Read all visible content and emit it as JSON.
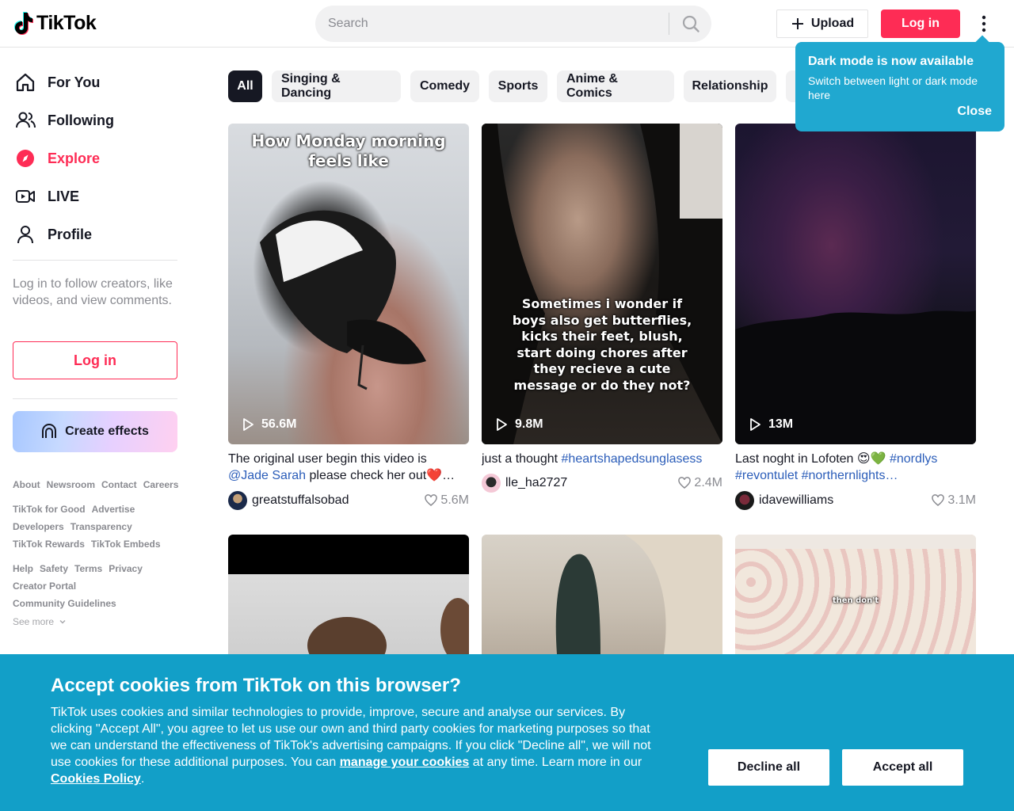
{
  "header": {
    "logo_text": "TikTok",
    "search_placeholder": "Search",
    "upload_label": "Upload",
    "login_label": "Log in"
  },
  "tooltip": {
    "title": "Dark mode is now available",
    "body": "Switch between light or dark mode here",
    "close_label": "Close"
  },
  "sidebar": {
    "nav": [
      {
        "label": "For You",
        "icon": "home-icon"
      },
      {
        "label": "Following",
        "icon": "following-icon"
      },
      {
        "label": "Explore",
        "icon": "compass-icon",
        "active": true
      },
      {
        "label": "LIVE",
        "icon": "live-icon"
      },
      {
        "label": "Profile",
        "icon": "profile-icon"
      }
    ],
    "login_note": "Log in to follow creators, like videos, and view comments.",
    "login_label": "Log in",
    "effects_label": "Create effects",
    "links_1": [
      "About",
      "Newsroom",
      "Contact",
      "Careers"
    ],
    "links_2": [
      "TikTok for Good",
      "Advertise",
      "Developers",
      "Transparency",
      "TikTok Rewards",
      "TikTok Embeds"
    ],
    "links_3": [
      "Help",
      "Safety",
      "Terms",
      "Privacy",
      "Creator Portal",
      "Community Guidelines"
    ],
    "see_more": "See more"
  },
  "categories": [
    "All",
    "Singing & Dancing",
    "Comedy",
    "Sports",
    "Anime & Comics",
    "Relationship"
  ],
  "videos": [
    {
      "caption": "How Monday morning feels like",
      "plays": "56.6M",
      "desc_text": "The original user begin this video is ",
      "desc_tag": "@Jade Sarah",
      "desc_tail": " please check her out❤️…",
      "author": "greatstuffalsobad",
      "likes": "5.6M"
    },
    {
      "caption": "Sometimes i wonder if boys also get butterflies, kicks their feet, blush, start doing chores after they recieve a cute message or do they not?",
      "plays": "9.8M",
      "desc_text": "just a thought ",
      "desc_tag": "#heartshapedsunglasess",
      "desc_tail": "",
      "author": "lle_ha2727",
      "likes": "2.4M"
    },
    {
      "caption": "",
      "plays": "13M",
      "desc_text": "Last noght in Lofoten 😍💚 ",
      "desc_tag": "#nordlys #revontulet #northernlights…",
      "desc_tail": "",
      "author": "idavewilliams",
      "likes": "3.1M"
    },
    {
      "caption": ""
    },
    {
      "caption": ""
    },
    {
      "caption": "then don't"
    }
  ],
  "cookie": {
    "title": "Accept cookies from TikTok on this browser?",
    "text_1": "TikTok uses cookies and similar technologies to provide, improve, secure and analyse our services. By clicking \"Accept All\", you agree to let us use our own and third party cookies for marketing purposes so that we can understand the effectiveness of TikTok's advertising campaigns. If you click \"Decline all\", we will not use cookies for these additional purposes. You can ",
    "link_manage": "manage your cookies",
    "text_2": " at any time. Learn more in our ",
    "link_policy": "Cookies Policy",
    "text_3": ".",
    "decline_label": "Decline all",
    "accept_label": "Accept all"
  },
  "colors": {
    "brand": "#fe2c55",
    "tooltip": "#20a8d0",
    "cookie_banner": "#129fc8",
    "hashtag": "#2b5db9"
  }
}
